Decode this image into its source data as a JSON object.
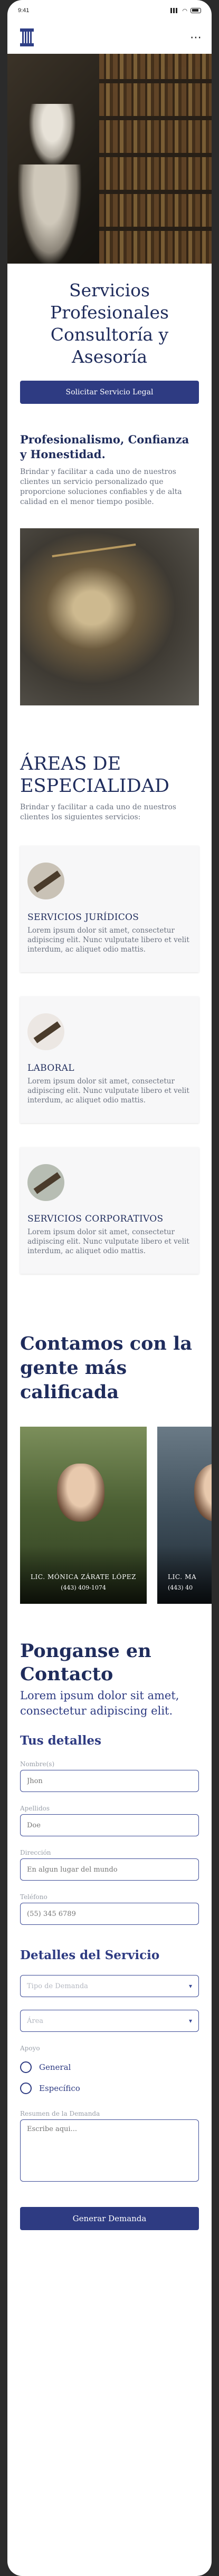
{
  "status": {
    "time": "9:41"
  },
  "hero": {
    "title": "Servicios Profesionales Consultoría y Asesoría",
    "cta": "Solicitar Servicio Legal"
  },
  "intro": {
    "heading": "Profesionalismo, Confianza y Honestidad.",
    "text": "Brindar y facilitar a cada uno de nuestros clientes un servicio personalizado que proporcione soluciones confiables y de alta calidad en el menor tiempo posible."
  },
  "areas": {
    "heading": "ÁREAS DE ESPECIALIDAD",
    "text": "Brindar y facilitar a cada uno de nuestros clientes los siguientes servicios:",
    "cards": [
      {
        "title": "SERVICIOS JURÍDICOS",
        "text": "Lorem ipsum dolor sit amet, consectetur adipiscing elit. Nunc vulputate libero et velit interdum, ac aliquet odio mattis.",
        "icon": "gavel-icon"
      },
      {
        "title": "LABORAL",
        "text": "Lorem ipsum dolor sit amet, consectetur adipiscing elit. Nunc vulputate libero et velit interdum, ac aliquet odio mattis.",
        "icon": "gavel-icon"
      },
      {
        "title": "SERVICIOS CORPORATIVOS",
        "text": "Lorem ipsum dolor sit amet, consectetur adipiscing elit. Nunc vulputate libero et velit interdum, ac aliquet odio mattis.",
        "icon": "pen-icon"
      }
    ]
  },
  "team": {
    "heading": "Contamos con la gente más calificada",
    "members": [
      {
        "name": "LIC. MÓNICA ZÁRATE LÓPEZ",
        "phone": "(443) 409-1074"
      },
      {
        "name": "LIC. MA",
        "phone": "(443) 40"
      }
    ]
  },
  "contact": {
    "heading": "Ponganse en Contacto",
    "text": "Lorem ipsum dolor sit amet, consectetur adipiscing elit.",
    "details_heading": "Tus detalles",
    "fields": {
      "name_label": "Nombre(s)",
      "name_placeholder": "Jhon",
      "last_label": "Apellidos",
      "last_placeholder": "Doe",
      "address_label": "Dirección",
      "address_placeholder": "En algun lugar del mundo",
      "phone_label": "Teléfono",
      "phone_placeholder": "(55) 345 6789"
    },
    "service_heading": "Detalles del Servicio",
    "demand_type": "Tipo de Demanda",
    "area": "Área",
    "support_label": "Apoyo",
    "support_options": [
      "General",
      "Específico"
    ],
    "summary_label": "Resumen de la Demanda",
    "summary_placeholder": "Escribe aqui...",
    "submit": "Generar Demanda"
  }
}
